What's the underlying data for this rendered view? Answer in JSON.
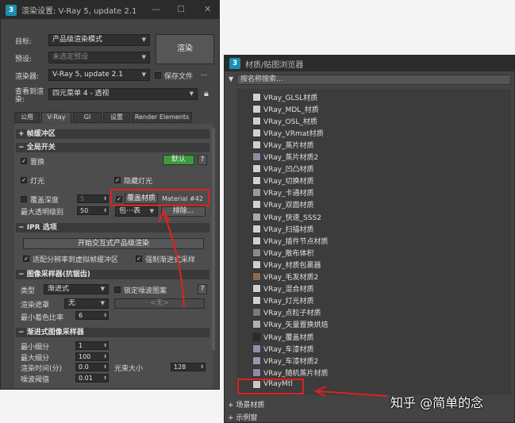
{
  "render_window": {
    "title": "渲染设置: V-Ray 5, update 2.1",
    "app_icon": "3",
    "labels": {
      "target": "目标:",
      "preset": "预设:",
      "renderer": "渲染器:",
      "view": "查看到渲染:"
    },
    "target_value": "产品级渲染模式",
    "preset_value": "未选定预设",
    "renderer_value": "V-Ray 5, update 2.1",
    "save_file": "保存文件",
    "ellipsis": "...",
    "view_value": "四元菜单 4 - 透视",
    "render_button": "渲染",
    "tabs": [
      "公用",
      "V-Ray",
      "GI",
      "设置",
      "Render Elements"
    ],
    "sections": {
      "frame_buffer": "帧缓冲区",
      "global_switch": "全局开关",
      "ipr": "IPR 选项",
      "image_sampler": "图像采样器(抗锯齿)",
      "progressive": "渐进式图像采样器"
    },
    "global": {
      "displacement": "置换",
      "default_button": "默认",
      "help": "?",
      "lights": "灯光",
      "hidden_lights": "隐藏灯光",
      "override_depth": "覆盖深度",
      "override_depth_value": "5",
      "max_transp": "最大透明级别",
      "max_transp_value": "50",
      "override_mtl": "覆盖材质",
      "override_mtl_value": "Material #42",
      "include_dd": "包⋯表",
      "exclude": "排除..."
    },
    "ipr_opts": {
      "start_button": "开始交互式产品级渲染",
      "fit_res": "适配分辨率到虚拟帧缓冲区",
      "force_prog": "强制渐进式采样"
    },
    "sampler": {
      "type_label": "类型",
      "type_value": "渐进式",
      "lock_noise": "锁定噪波图案",
      "help": "?",
      "mask_label": "渲染遮罩",
      "mask_value": "无",
      "mask_none": "<无>",
      "min_shading_label": "最小着色比率",
      "min_shading_value": "6"
    },
    "progressive_opts": {
      "min_sub": "最小细分",
      "min_sub_value": "1",
      "max_sub": "最大细分",
      "max_sub_value": "100",
      "render_time": "渲染时间(分)",
      "render_time_value": "0.0",
      "noise": "噪波阈值",
      "noise_value": "0.01",
      "bundle": "光束大小",
      "bundle_value": "128"
    }
  },
  "material_browser": {
    "title": "材质/贴图浏览器",
    "search_placeholder": "按名称搜索...",
    "items": [
      {
        "name": "VRay_GLSL材质",
        "swatch": "#d0d0d0"
      },
      {
        "name": "VRay_MDL_材质",
        "swatch": "#d0d0d0"
      },
      {
        "name": "VRay_OSL_材质",
        "swatch": "#d0d0d0"
      },
      {
        "name": "VRay_VRmat材质",
        "swatch": "#d0d0d0"
      },
      {
        "name": "VRay_蒸片材质",
        "swatch": "#d0d0d0"
      },
      {
        "name": "VRay_蒸片材质2",
        "swatch": "#8c8ca0"
      },
      {
        "name": "VRay_凹凸材质",
        "swatch": "#d0d0d0"
      },
      {
        "name": "VRay_切换材质",
        "swatch": "#d0d0d0"
      },
      {
        "name": "VRay_卡通材质",
        "swatch": "#9a9a9a"
      },
      {
        "name": "VRay_双面材质",
        "swatch": "#d0d0d0"
      },
      {
        "name": "VRay_快速_SSS2",
        "swatch": "#aaaaaa"
      },
      {
        "name": "VRay_扫描材质",
        "swatch": "#d0d0d0"
      },
      {
        "name": "VRay_插件节点材质",
        "swatch": "#d0d0d0"
      },
      {
        "name": "VRay_散布体积",
        "swatch": "#8a8a8a"
      },
      {
        "name": "VRay_材质包裹器",
        "swatch": "#d0d0d0"
      },
      {
        "name": "VRay_毛发材质2",
        "swatch": "#8a6a50"
      },
      {
        "name": "VRay_混合材质",
        "swatch": "#d0d0d0"
      },
      {
        "name": "VRay_灯光材质",
        "swatch": "#d0d0d0"
      },
      {
        "name": "VRay_点粒子材质",
        "swatch": "#7a7a7a"
      },
      {
        "name": "VRay_矢量置换烘焙",
        "swatch": "#b0b0b0"
      },
      {
        "name": "VRay_覆盖材质",
        "swatch": "#2a2a2a"
      },
      {
        "name": "VRay_车漆材质",
        "swatch": "#9090a8"
      },
      {
        "name": "VRay_车漆材质2",
        "swatch": "#9898b0"
      },
      {
        "name": "VRay_随机蒸片材质",
        "swatch": "#8c8ca0"
      },
      {
        "name": "VRayMtl",
        "swatch": "#c8c8c8"
      }
    ],
    "section_scene": "场景材质",
    "section_sample": "示例窗"
  },
  "watermark": "知乎 @简单的念",
  "colors": {
    "annotation_red": "#e02020",
    "dark_bg": "#444444",
    "titlebar": "#2b2b2b"
  }
}
